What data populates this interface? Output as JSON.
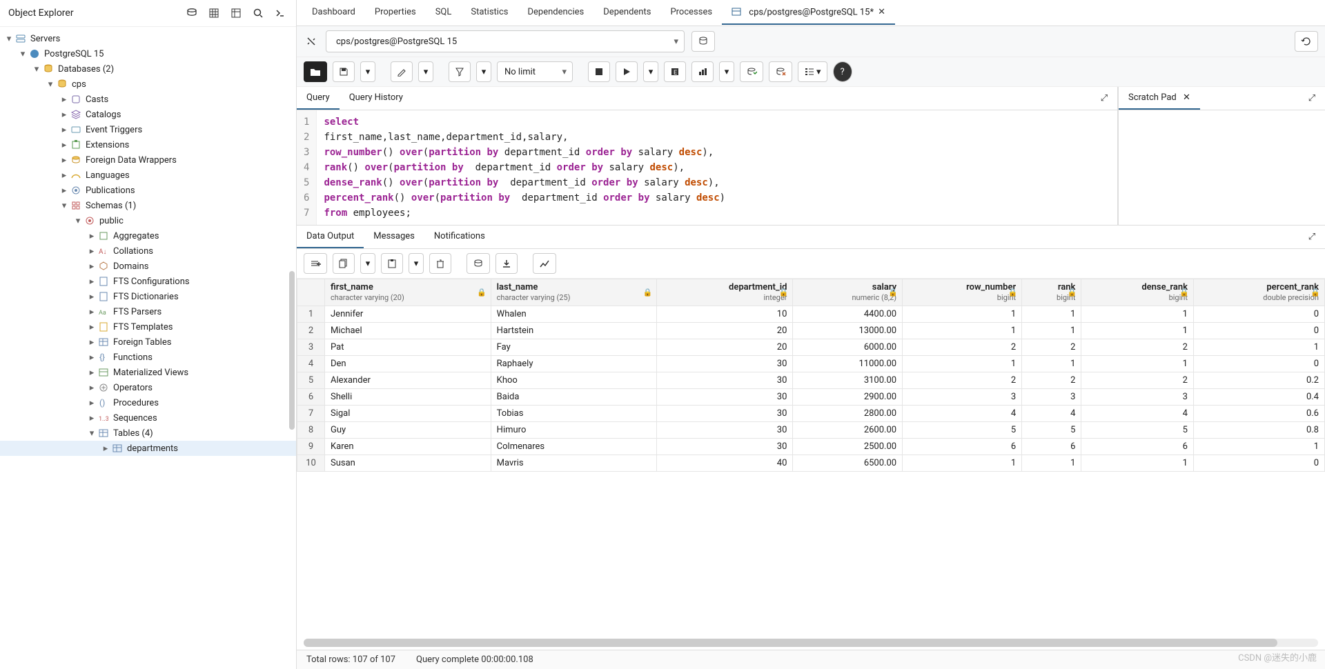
{
  "sidebar": {
    "title": "Object Explorer",
    "nodes": {
      "servers": "Servers",
      "pg15": "PostgreSQL 15",
      "databases": "Databases (2)",
      "cps": "cps",
      "casts": "Casts",
      "catalogs": "Catalogs",
      "eventtriggers": "Event Triggers",
      "extensions": "Extensions",
      "fdw": "Foreign Data Wrappers",
      "languages": "Languages",
      "publications": "Publications",
      "schemas": "Schemas (1)",
      "public": "public",
      "aggregates": "Aggregates",
      "collations": "Collations",
      "domains": "Domains",
      "ftsconf": "FTS Configurations",
      "ftsdict": "FTS Dictionaries",
      "ftspars": "FTS Parsers",
      "ftstmpl": "FTS Templates",
      "foreigntables": "Foreign Tables",
      "functions": "Functions",
      "matviews": "Materialized Views",
      "operators": "Operators",
      "procedures": "Procedures",
      "sequences": "Sequences",
      "tables": "Tables (4)",
      "departments": "departments"
    }
  },
  "tabs": [
    "Dashboard",
    "Properties",
    "SQL",
    "Statistics",
    "Dependencies",
    "Dependents",
    "Processes"
  ],
  "active_tab": "cps/postgres@PostgreSQL 15*",
  "connection": "cps/postgres@PostgreSQL 15",
  "limit": "No limit",
  "query_tabs": {
    "query": "Query",
    "history": "Query History"
  },
  "scratch": {
    "label": "Scratch Pad"
  },
  "sql_lines": [
    "1",
    "2",
    "3",
    "4",
    "5",
    "6",
    "7"
  ],
  "sql": {
    "l1": "select",
    "l2": "first_name,last_name,department_id,salary,",
    "l3a": "row_number",
    "l3b": "() ",
    "l3c": "over",
    "l3d": "(",
    "l3e": "partition by",
    "l3f": " department_id ",
    "l3g": "order by",
    "l3h": " salary ",
    "l3i": "desc",
    "l3j": "),",
    "l4a": "rank",
    "l4b": "() ",
    "l4c": "over",
    "l4d": "(",
    "l4e": "partition by",
    "l4f": "  department_id ",
    "l4g": "order by",
    "l4h": " salary ",
    "l4i": "desc",
    "l4j": "),",
    "l5a": "dense_rank",
    "l5b": "() ",
    "l5c": "over",
    "l5d": "(",
    "l5e": "partition by",
    "l5f": "  department_id ",
    "l5g": "order by",
    "l5h": " salary ",
    "l5i": "desc",
    "l5j": "),",
    "l6a": "percent_rank",
    "l6b": "() ",
    "l6c": "over",
    "l6d": "(",
    "l6e": "partition by",
    "l6f": "  department_id ",
    "l6g": "order by",
    "l6h": " salary ",
    "l6i": "desc",
    "l6j": ")",
    "l7a": "from",
    "l7b": " employees;"
  },
  "result_tabs": [
    "Data Output",
    "Messages",
    "Notifications"
  ],
  "columns": [
    {
      "name": "first_name",
      "type": "character varying (20)"
    },
    {
      "name": "last_name",
      "type": "character varying (25)"
    },
    {
      "name": "department_id",
      "type": "integer"
    },
    {
      "name": "salary",
      "type": "numeric (8,2)"
    },
    {
      "name": "row_number",
      "type": "bigint"
    },
    {
      "name": "rank",
      "type": "bigint"
    },
    {
      "name": "dense_rank",
      "type": "bigint"
    },
    {
      "name": "percent_rank",
      "type": "double precision"
    }
  ],
  "rows": [
    {
      "n": "1",
      "first": "Jennifer",
      "last": "Whalen",
      "dept": "10",
      "sal": "4400.00",
      "rn": "1",
      "rk": "1",
      "dr": "1",
      "pr": "0"
    },
    {
      "n": "2",
      "first": "Michael",
      "last": "Hartstein",
      "dept": "20",
      "sal": "13000.00",
      "rn": "1",
      "rk": "1",
      "dr": "1",
      "pr": "0"
    },
    {
      "n": "3",
      "first": "Pat",
      "last": "Fay",
      "dept": "20",
      "sal": "6000.00",
      "rn": "2",
      "rk": "2",
      "dr": "2",
      "pr": "1"
    },
    {
      "n": "4",
      "first": "Den",
      "last": "Raphaely",
      "dept": "30",
      "sal": "11000.00",
      "rn": "1",
      "rk": "1",
      "dr": "1",
      "pr": "0"
    },
    {
      "n": "5",
      "first": "Alexander",
      "last": "Khoo",
      "dept": "30",
      "sal": "3100.00",
      "rn": "2",
      "rk": "2",
      "dr": "2",
      "pr": "0.2"
    },
    {
      "n": "6",
      "first": "Shelli",
      "last": "Baida",
      "dept": "30",
      "sal": "2900.00",
      "rn": "3",
      "rk": "3",
      "dr": "3",
      "pr": "0.4"
    },
    {
      "n": "7",
      "first": "Sigal",
      "last": "Tobias",
      "dept": "30",
      "sal": "2800.00",
      "rn": "4",
      "rk": "4",
      "dr": "4",
      "pr": "0.6"
    },
    {
      "n": "8",
      "first": "Guy",
      "last": "Himuro",
      "dept": "30",
      "sal": "2600.00",
      "rn": "5",
      "rk": "5",
      "dr": "5",
      "pr": "0.8"
    },
    {
      "n": "9",
      "first": "Karen",
      "last": "Colmenares",
      "dept": "30",
      "sal": "2500.00",
      "rn": "6",
      "rk": "6",
      "dr": "6",
      "pr": "1"
    },
    {
      "n": "10",
      "first": "Susan",
      "last": "Mavris",
      "dept": "40",
      "sal": "6500.00",
      "rn": "1",
      "rk": "1",
      "dr": "1",
      "pr": "0"
    }
  ],
  "status": {
    "rows": "Total rows: 107 of 107",
    "time": "Query complete 00:00:00.108"
  },
  "watermark": "CSDN @迷失的小鹿"
}
